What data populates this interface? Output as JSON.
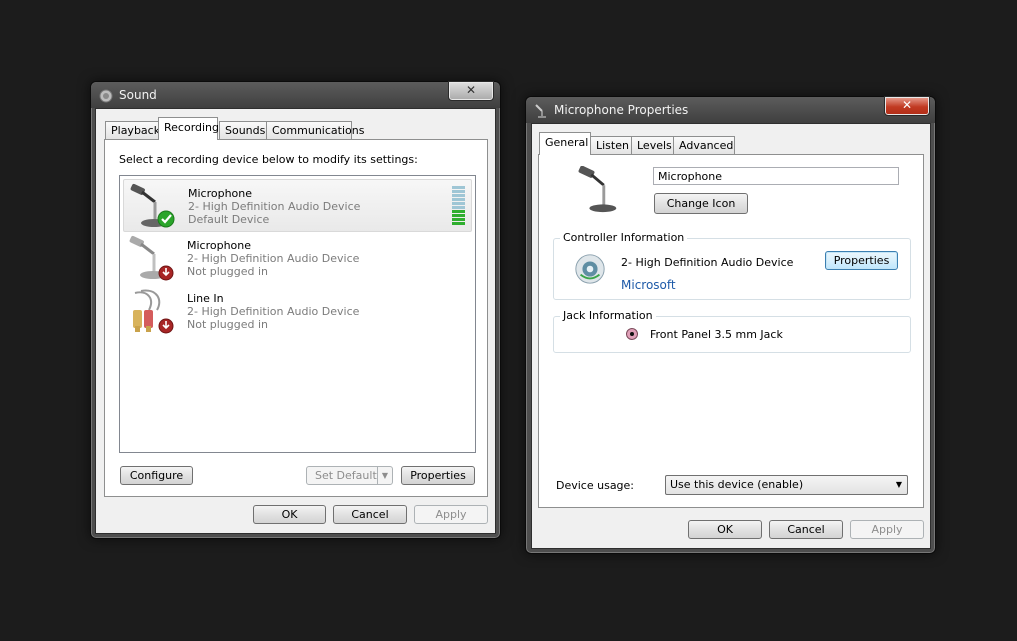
{
  "sound_window": {
    "title": "Sound",
    "close_label": "✕",
    "tabs": [
      {
        "label": "Playback"
      },
      {
        "label": "Recording"
      },
      {
        "label": "Sounds"
      },
      {
        "label": "Communications"
      }
    ],
    "instruction": "Select a recording device below to modify its settings:",
    "devices": [
      {
        "name": "Microphone",
        "driver": "2- High Definition Audio Device",
        "status": "Default Device",
        "icon": "microphone-default-icon"
      },
      {
        "name": "Microphone",
        "driver": "2- High Definition Audio Device",
        "status": "Not plugged in",
        "icon": "microphone-unplugged-icon"
      },
      {
        "name": "Line In",
        "driver": "2- High Definition Audio Device",
        "status": "Not plugged in",
        "icon": "line-in-unplugged-icon"
      }
    ],
    "level_meter": {
      "active_fraction": 0.4,
      "green": "#2fae2f",
      "idle": "#9fc6d5"
    },
    "buttons": {
      "configure": "Configure",
      "set_default": "Set Default",
      "properties": "Properties",
      "ok": "OK",
      "cancel": "Cancel",
      "apply": "Apply"
    }
  },
  "props_window": {
    "title": "Microphone Properties",
    "close_label": "✕",
    "tabs": [
      {
        "label": "General"
      },
      {
        "label": "Listen"
      },
      {
        "label": "Levels"
      },
      {
        "label": "Advanced"
      }
    ],
    "device_name_value": "Microphone",
    "change_icon_label": "Change Icon",
    "controller": {
      "group_title": "Controller Information",
      "device": "2- High Definition Audio Device",
      "vendor": "Microsoft",
      "properties_label": "Properties"
    },
    "jack": {
      "group_title": "Jack Information",
      "label": "Front Panel 3.5 mm Jack",
      "color": "#e0a0b8"
    },
    "device_usage": {
      "label": "Device usage:",
      "value": "Use this device (enable)"
    },
    "buttons": {
      "ok": "OK",
      "cancel": "Cancel",
      "apply": "Apply"
    }
  },
  "colors": {
    "vendor_link": "#1e5aa8",
    "disabled_text": "#8d8d8d",
    "background": "#1c1c1c"
  }
}
